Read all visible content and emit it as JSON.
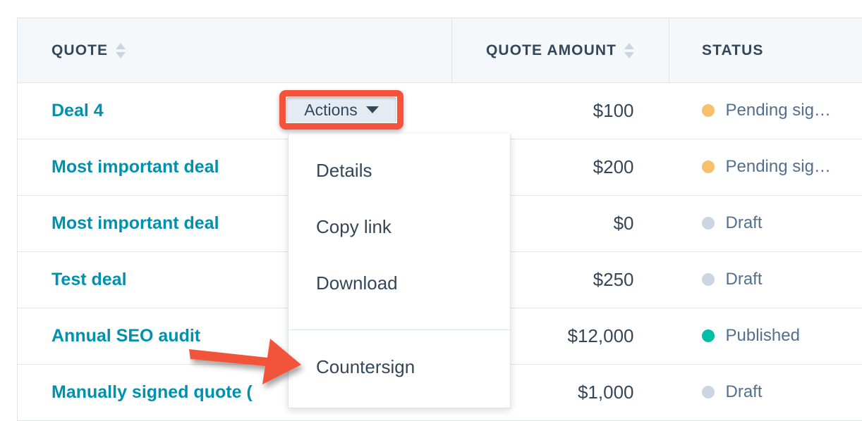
{
  "table": {
    "columns": [
      {
        "key": "quote",
        "label": "QUOTE",
        "sortable": true,
        "align": "left"
      },
      {
        "key": "amount",
        "label": "QUOTE AMOUNT",
        "sortable": true,
        "align": "right"
      },
      {
        "key": "status",
        "label": "STATUS",
        "sortable": false,
        "align": "left"
      }
    ],
    "rows": [
      {
        "quote": "Deal 4",
        "amount": "$100",
        "status": "Pending sig…",
        "status_color": "#f5c26b"
      },
      {
        "quote": "Most important deal",
        "amount": "$200",
        "status": "Pending sig…",
        "status_color": "#f5c26b"
      },
      {
        "quote": "Most important deal",
        "amount": "$0",
        "status": "Draft",
        "status_color": "#cbd6e2"
      },
      {
        "quote": "Test deal",
        "amount": "$250",
        "status": "Draft",
        "status_color": "#cbd6e2"
      },
      {
        "quote": "Annual SEO audit",
        "amount": "$12,000",
        "status": "Published",
        "status_color": "#00bda5"
      },
      {
        "quote": "Manually signed quote (",
        "amount": "$1,000",
        "status": "Draft",
        "status_color": "#cbd6e2"
      }
    ]
  },
  "actions_button": {
    "label": "Actions",
    "caret": "chevron-down-icon"
  },
  "actions_menu": {
    "items": [
      {
        "label": "Details"
      },
      {
        "label": "Copy link"
      },
      {
        "label": "Download"
      }
    ],
    "footer_items": [
      {
        "label": "Countersign"
      }
    ]
  },
  "annotations": {
    "highlight_color": "#f2533a",
    "arrow_color": "#f2533a"
  }
}
